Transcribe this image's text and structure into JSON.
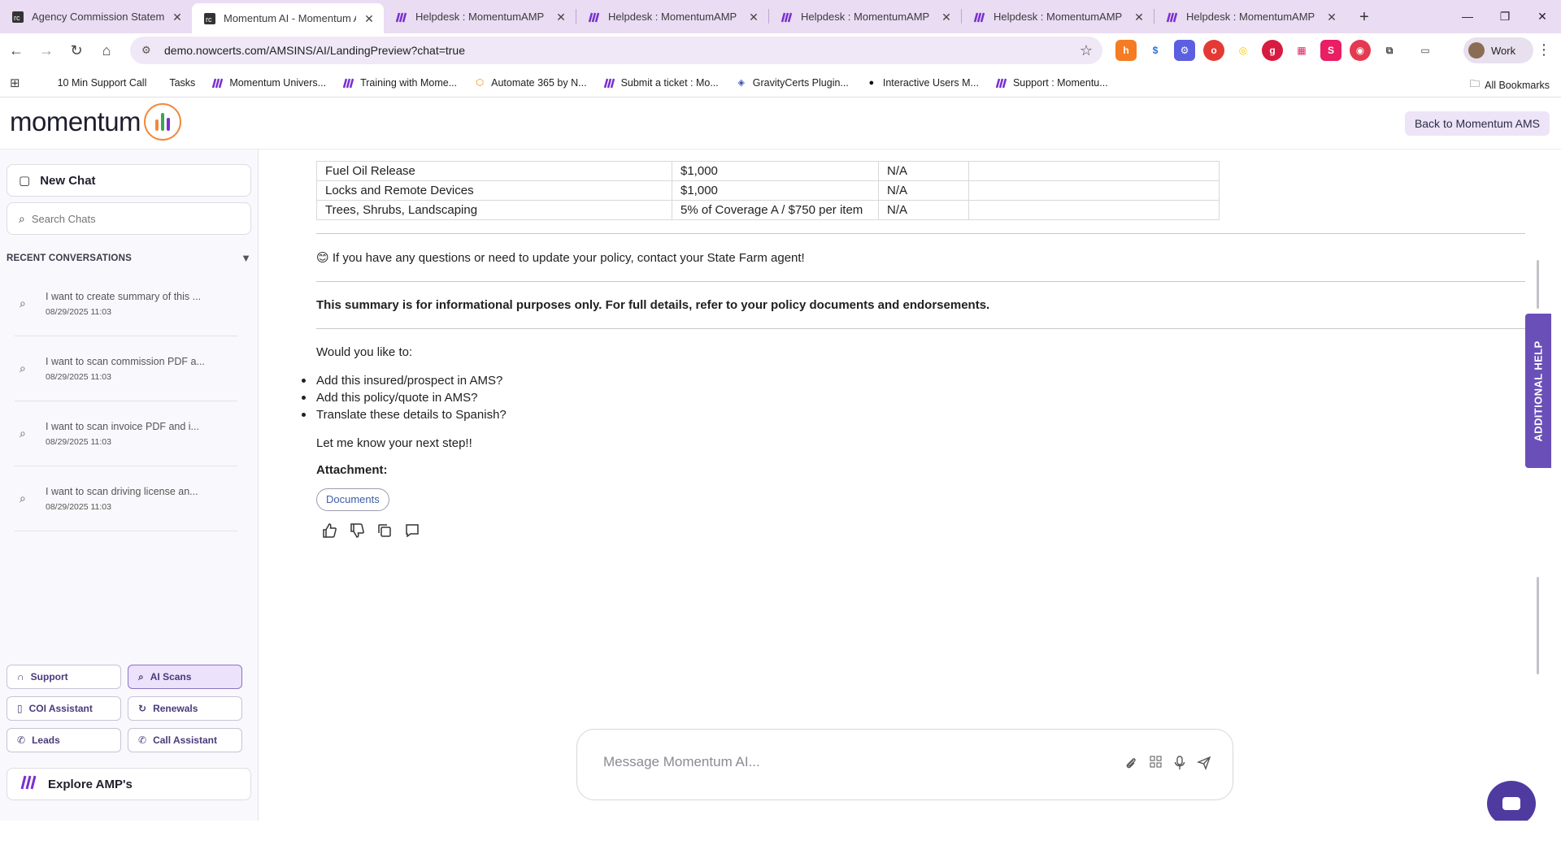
{
  "browser": {
    "tabs": [
      {
        "title": "Agency Commission Statement",
        "favicon": "rc-icon",
        "active": false
      },
      {
        "title": "Momentum AI - Momentum AI",
        "favicon": "rc-icon",
        "active": true
      },
      {
        "title": "Helpdesk : MomentumAMP",
        "favicon": "momentum-icon",
        "active": false
      },
      {
        "title": "Helpdesk : MomentumAMP",
        "favicon": "momentum-icon",
        "active": false
      },
      {
        "title": "Helpdesk : MomentumAMP",
        "favicon": "momentum-icon",
        "active": false
      },
      {
        "title": "Helpdesk : MomentumAMP",
        "favicon": "momentum-icon",
        "active": false
      },
      {
        "title": "Helpdesk : MomentumAMP",
        "favicon": "momentum-icon",
        "active": false
      }
    ],
    "url": "demo.nowcerts.com/AMSINS/AI/LandingPreview?chat=true",
    "profile": "Work",
    "bookmarks": [
      "10 Min Support Call",
      "Tasks",
      "Momentum Univers...",
      "Training with Mome...",
      "Automate 365 by N...",
      "Submit a ticket : Mo...",
      "GravityCerts Plugin...",
      "Interactive Users M...",
      "Support : Momentu..."
    ],
    "all_bookmarks": "All Bookmarks"
  },
  "header": {
    "logo_text": "momentum",
    "back_button": "Back to Momentum AMS"
  },
  "sidebar": {
    "new_chat": "New Chat",
    "search_placeholder": "Search Chats",
    "recent_title": "RECENT CONVERSATIONS",
    "conversations": [
      {
        "title": "I want to create summary of this ...",
        "date": "08/29/2025 11:03"
      },
      {
        "title": "I want to scan commission PDF a...",
        "date": "08/29/2025 11:03"
      },
      {
        "title": "I want to scan invoice PDF and i...",
        "date": "08/29/2025 11:03"
      },
      {
        "title": "I want to scan driving license an...",
        "date": "08/29/2025 11:03"
      }
    ],
    "quick_actions": [
      {
        "label": "Support",
        "icon": "headset-icon",
        "active": false
      },
      {
        "label": "AI Scans",
        "icon": "search-icon",
        "active": true
      },
      {
        "label": "COI Assistant",
        "icon": "document-icon",
        "active": false
      },
      {
        "label": "Renewals",
        "icon": "refresh-icon",
        "active": false
      },
      {
        "label": "Leads",
        "icon": "phone-icon",
        "active": false
      },
      {
        "label": "Call Assistant",
        "icon": "phone-icon",
        "active": false
      }
    ],
    "explore": "Explore AMP's"
  },
  "main": {
    "table_rows": [
      [
        "Fuel Oil Release",
        "$1,000",
        "N/A",
        ""
      ],
      [
        "Locks and Remote Devices",
        "$1,000",
        "N/A",
        ""
      ],
      [
        "Trees, Shrubs, Landscaping",
        "5% of Coverage A / $750 per item",
        "N/A",
        ""
      ]
    ],
    "contact_line": "If you have any questions or need to update your policy, contact your State Farm agent!",
    "disclaimer": "This summary is for informational purposes only. For full details, refer to your policy documents and endorsements.",
    "prompt": "Would you like to:",
    "options": [
      "Add this insured/prospect in AMS?",
      "Add this policy/quote in AMS?",
      "Translate these details to Spanish?"
    ],
    "next_step": "Let me know your next step!!",
    "attachment_label": "Attachment:",
    "attachment_chip": "Documents"
  },
  "help_tab": "ADDITIONAL HELP",
  "composer": {
    "placeholder": "Message Momentum AI..."
  },
  "colors": {
    "accent": "#6b4fb8",
    "tabbar": "#e9dcf3"
  }
}
